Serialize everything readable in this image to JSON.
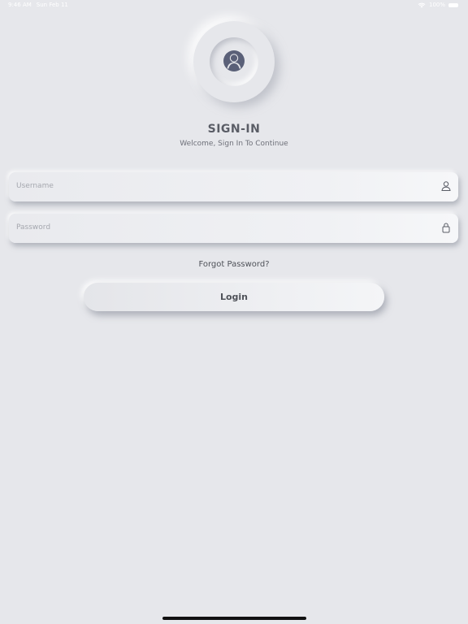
{
  "status_bar": {
    "time": "9:46 AM",
    "date": "Sun Feb 11",
    "battery": "100%",
    "icons": [
      "wifi-icon",
      "battery-icon"
    ]
  },
  "header": {
    "title": "SIGN-IN",
    "subtitle": "Welcome, Sign In To Continue",
    "avatar_icon": "user-avatar-icon"
  },
  "form": {
    "username": {
      "placeholder": "Username",
      "value": "",
      "icon": "person-icon"
    },
    "password": {
      "placeholder": "Password",
      "value": "",
      "icon": "lock-icon"
    },
    "forgot_label": "Forgot Password?",
    "login_label": "Login"
  },
  "colors": {
    "background": "#e6e7eb",
    "accent": "#5a6078",
    "text": "#4f5259"
  }
}
